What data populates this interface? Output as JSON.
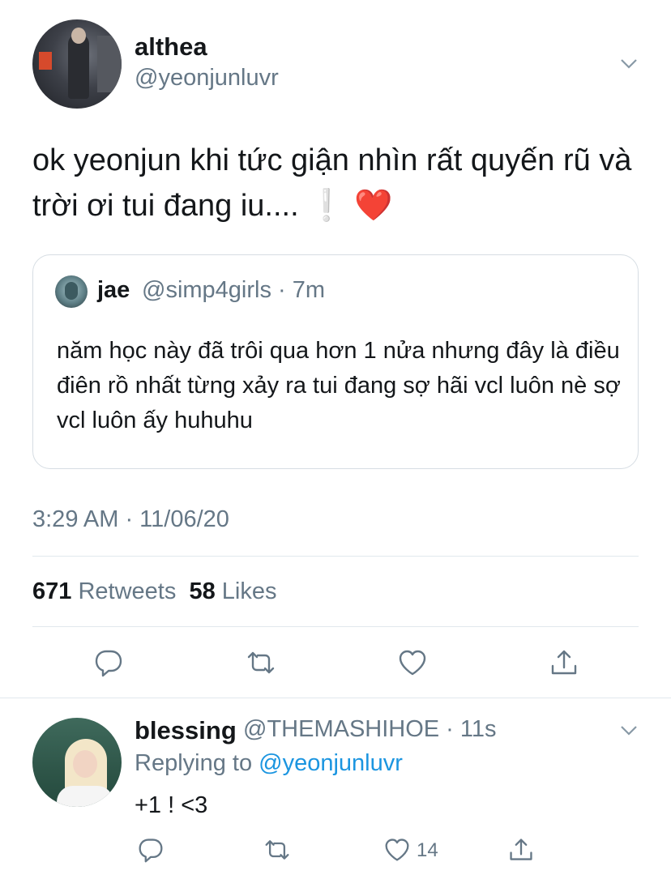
{
  "tweet": {
    "display_name": "althea",
    "handle": "@yeonjunluvr",
    "text": "ok yeonjun khi tức giận nhìn rất quyến rũ và trời ơi tui đang iu....",
    "emoji_exclamation": "❕",
    "emoji_heart": "❤️",
    "timestamp": "3:29 AM · 11/06/20",
    "retweets_count": "671",
    "retweets_label": "Retweets",
    "likes_count": "58",
    "likes_label": "Likes"
  },
  "quoted": {
    "display_name": "jae",
    "handle_time": "@simp4girls · 7m",
    "text": "năm học này đã trôi qua hơn 1 nửa nhưng đây là điều điên rồ nhất từng xảy ra tui đang sợ hãi vcl luôn nè sợ vcl luôn ấy huhuhu"
  },
  "reply": {
    "display_name": "blessing",
    "handle_time": "@THEMASHIHOE · 11s",
    "replying_prefix": "Replying to",
    "replying_mention": "@yeonjunluvr",
    "text": "+1 ! <3",
    "like_count": "14"
  },
  "icons": [
    "chevron-down-icon",
    "reply-icon",
    "retweet-icon",
    "like-icon",
    "share-icon"
  ],
  "colors": {
    "text": "#14171a",
    "secondary": "#657786",
    "link": "#1b95e0",
    "border": "#e1e8ed",
    "heart": "#e0245e"
  }
}
